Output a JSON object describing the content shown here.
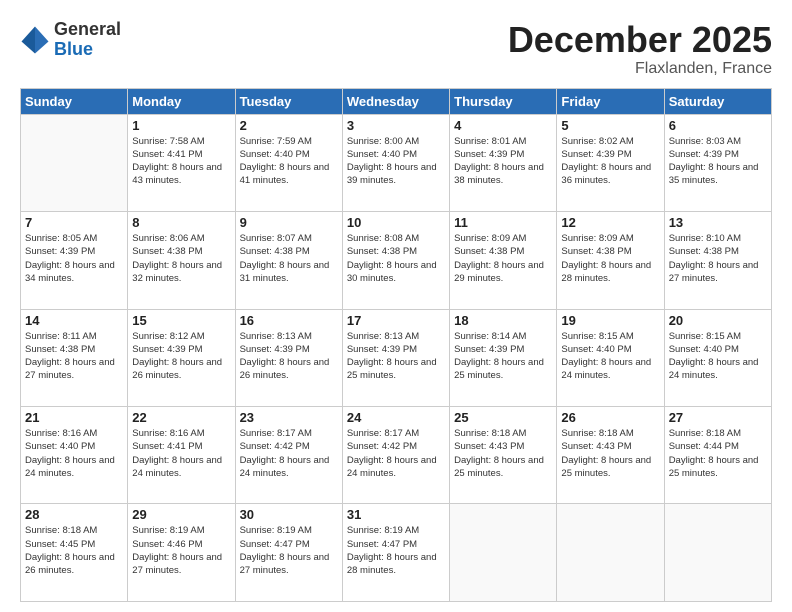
{
  "logo": {
    "general": "General",
    "blue": "Blue"
  },
  "title": "December 2025",
  "location": "Flaxlanden, France",
  "headers": [
    "Sunday",
    "Monday",
    "Tuesday",
    "Wednesday",
    "Thursday",
    "Friday",
    "Saturday"
  ],
  "weeks": [
    [
      {
        "num": "",
        "sunrise": "",
        "sunset": "",
        "daylight": ""
      },
      {
        "num": "1",
        "sunrise": "Sunrise: 7:58 AM",
        "sunset": "Sunset: 4:41 PM",
        "daylight": "Daylight: 8 hours and 43 minutes."
      },
      {
        "num": "2",
        "sunrise": "Sunrise: 7:59 AM",
        "sunset": "Sunset: 4:40 PM",
        "daylight": "Daylight: 8 hours and 41 minutes."
      },
      {
        "num": "3",
        "sunrise": "Sunrise: 8:00 AM",
        "sunset": "Sunset: 4:40 PM",
        "daylight": "Daylight: 8 hours and 39 minutes."
      },
      {
        "num": "4",
        "sunrise": "Sunrise: 8:01 AM",
        "sunset": "Sunset: 4:39 PM",
        "daylight": "Daylight: 8 hours and 38 minutes."
      },
      {
        "num": "5",
        "sunrise": "Sunrise: 8:02 AM",
        "sunset": "Sunset: 4:39 PM",
        "daylight": "Daylight: 8 hours and 36 minutes."
      },
      {
        "num": "6",
        "sunrise": "Sunrise: 8:03 AM",
        "sunset": "Sunset: 4:39 PM",
        "daylight": "Daylight: 8 hours and 35 minutes."
      }
    ],
    [
      {
        "num": "7",
        "sunrise": "Sunrise: 8:05 AM",
        "sunset": "Sunset: 4:39 PM",
        "daylight": "Daylight: 8 hours and 34 minutes."
      },
      {
        "num": "8",
        "sunrise": "Sunrise: 8:06 AM",
        "sunset": "Sunset: 4:38 PM",
        "daylight": "Daylight: 8 hours and 32 minutes."
      },
      {
        "num": "9",
        "sunrise": "Sunrise: 8:07 AM",
        "sunset": "Sunset: 4:38 PM",
        "daylight": "Daylight: 8 hours and 31 minutes."
      },
      {
        "num": "10",
        "sunrise": "Sunrise: 8:08 AM",
        "sunset": "Sunset: 4:38 PM",
        "daylight": "Daylight: 8 hours and 30 minutes."
      },
      {
        "num": "11",
        "sunrise": "Sunrise: 8:09 AM",
        "sunset": "Sunset: 4:38 PM",
        "daylight": "Daylight: 8 hours and 29 minutes."
      },
      {
        "num": "12",
        "sunrise": "Sunrise: 8:09 AM",
        "sunset": "Sunset: 4:38 PM",
        "daylight": "Daylight: 8 hours and 28 minutes."
      },
      {
        "num": "13",
        "sunrise": "Sunrise: 8:10 AM",
        "sunset": "Sunset: 4:38 PM",
        "daylight": "Daylight: 8 hours and 27 minutes."
      }
    ],
    [
      {
        "num": "14",
        "sunrise": "Sunrise: 8:11 AM",
        "sunset": "Sunset: 4:38 PM",
        "daylight": "Daylight: 8 hours and 27 minutes."
      },
      {
        "num": "15",
        "sunrise": "Sunrise: 8:12 AM",
        "sunset": "Sunset: 4:39 PM",
        "daylight": "Daylight: 8 hours and 26 minutes."
      },
      {
        "num": "16",
        "sunrise": "Sunrise: 8:13 AM",
        "sunset": "Sunset: 4:39 PM",
        "daylight": "Daylight: 8 hours and 26 minutes."
      },
      {
        "num": "17",
        "sunrise": "Sunrise: 8:13 AM",
        "sunset": "Sunset: 4:39 PM",
        "daylight": "Daylight: 8 hours and 25 minutes."
      },
      {
        "num": "18",
        "sunrise": "Sunrise: 8:14 AM",
        "sunset": "Sunset: 4:39 PM",
        "daylight": "Daylight: 8 hours and 25 minutes."
      },
      {
        "num": "19",
        "sunrise": "Sunrise: 8:15 AM",
        "sunset": "Sunset: 4:40 PM",
        "daylight": "Daylight: 8 hours and 24 minutes."
      },
      {
        "num": "20",
        "sunrise": "Sunrise: 8:15 AM",
        "sunset": "Sunset: 4:40 PM",
        "daylight": "Daylight: 8 hours and 24 minutes."
      }
    ],
    [
      {
        "num": "21",
        "sunrise": "Sunrise: 8:16 AM",
        "sunset": "Sunset: 4:40 PM",
        "daylight": "Daylight: 8 hours and 24 minutes."
      },
      {
        "num": "22",
        "sunrise": "Sunrise: 8:16 AM",
        "sunset": "Sunset: 4:41 PM",
        "daylight": "Daylight: 8 hours and 24 minutes."
      },
      {
        "num": "23",
        "sunrise": "Sunrise: 8:17 AM",
        "sunset": "Sunset: 4:42 PM",
        "daylight": "Daylight: 8 hours and 24 minutes."
      },
      {
        "num": "24",
        "sunrise": "Sunrise: 8:17 AM",
        "sunset": "Sunset: 4:42 PM",
        "daylight": "Daylight: 8 hours and 24 minutes."
      },
      {
        "num": "25",
        "sunrise": "Sunrise: 8:18 AM",
        "sunset": "Sunset: 4:43 PM",
        "daylight": "Daylight: 8 hours and 25 minutes."
      },
      {
        "num": "26",
        "sunrise": "Sunrise: 8:18 AM",
        "sunset": "Sunset: 4:43 PM",
        "daylight": "Daylight: 8 hours and 25 minutes."
      },
      {
        "num": "27",
        "sunrise": "Sunrise: 8:18 AM",
        "sunset": "Sunset: 4:44 PM",
        "daylight": "Daylight: 8 hours and 25 minutes."
      }
    ],
    [
      {
        "num": "28",
        "sunrise": "Sunrise: 8:18 AM",
        "sunset": "Sunset: 4:45 PM",
        "daylight": "Daylight: 8 hours and 26 minutes."
      },
      {
        "num": "29",
        "sunrise": "Sunrise: 8:19 AM",
        "sunset": "Sunset: 4:46 PM",
        "daylight": "Daylight: 8 hours and 27 minutes."
      },
      {
        "num": "30",
        "sunrise": "Sunrise: 8:19 AM",
        "sunset": "Sunset: 4:47 PM",
        "daylight": "Daylight: 8 hours and 27 minutes."
      },
      {
        "num": "31",
        "sunrise": "Sunrise: 8:19 AM",
        "sunset": "Sunset: 4:47 PM",
        "daylight": "Daylight: 8 hours and 28 minutes."
      },
      {
        "num": "",
        "sunrise": "",
        "sunset": "",
        "daylight": ""
      },
      {
        "num": "",
        "sunrise": "",
        "sunset": "",
        "daylight": ""
      },
      {
        "num": "",
        "sunrise": "",
        "sunset": "",
        "daylight": ""
      }
    ]
  ]
}
